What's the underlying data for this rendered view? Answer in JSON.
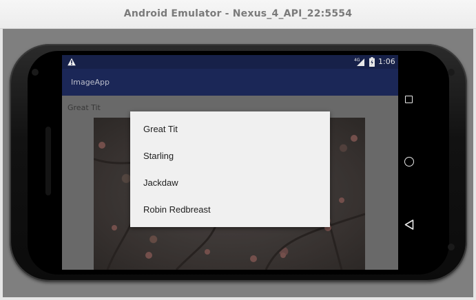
{
  "window": {
    "title": "Android Emulator - Nexus_4_API_22:5554"
  },
  "statusbar": {
    "warning_icon": "warning-icon",
    "signal_label": "4G",
    "time": "1:06"
  },
  "app": {
    "title": "ImageApp",
    "selected_label": "Great Tit"
  },
  "dialog": {
    "items": [
      {
        "label": "Great Tit"
      },
      {
        "label": "Starling"
      },
      {
        "label": "Jackdaw"
      },
      {
        "label": "Robin Redbreast"
      }
    ]
  },
  "navigation": {
    "icons": [
      "recents-icon",
      "home-icon",
      "back-icon"
    ]
  }
}
